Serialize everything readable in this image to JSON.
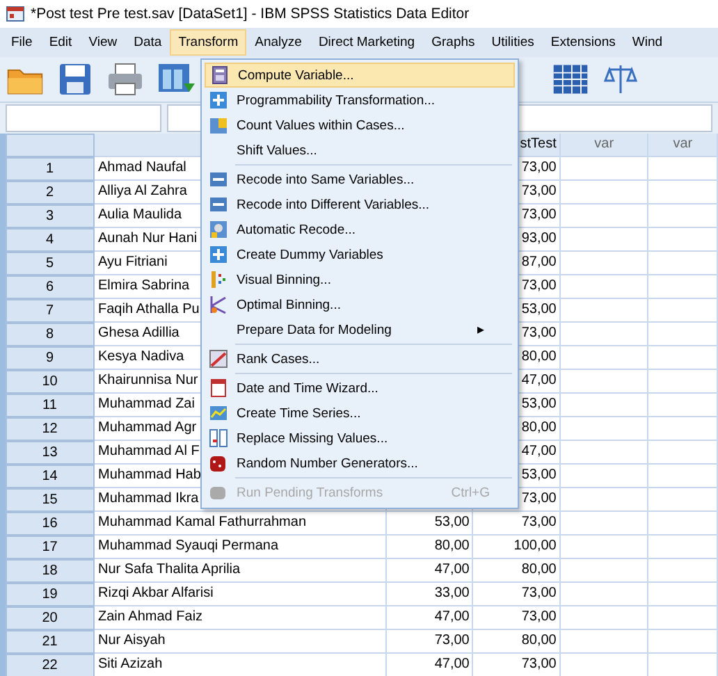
{
  "window": {
    "title": "*Post test Pre test.sav [DataSet1] - IBM SPSS Statistics Data Editor"
  },
  "menu_bar": [
    {
      "label": "File",
      "selected": false
    },
    {
      "label": "Edit",
      "selected": false
    },
    {
      "label": "View",
      "selected": false
    },
    {
      "label": "Data",
      "selected": false
    },
    {
      "label": "Transform",
      "selected": true
    },
    {
      "label": "Analyze",
      "selected": false
    },
    {
      "label": "Direct Marketing",
      "selected": false
    },
    {
      "label": "Graphs",
      "selected": false
    },
    {
      "label": "Utilities",
      "selected": false
    },
    {
      "label": "Extensions",
      "selected": false
    },
    {
      "label": "Wind",
      "selected": false
    }
  ],
  "grid": {
    "columns": [
      {
        "label": "stTest"
      },
      {
        "label": "var"
      },
      {
        "label": "var"
      }
    ],
    "rows": [
      {
        "num": "1",
        "name": "Ahmad Naufal",
        "post": "73,00"
      },
      {
        "num": "2",
        "name": "Alliya Al Zahra",
        "post": "73,00"
      },
      {
        "num": "3",
        "name": "Aulia Maulida",
        "post": "73,00"
      },
      {
        "num": "4",
        "name": "Aunah Nur Hani",
        "post": "93,00"
      },
      {
        "num": "5",
        "name": "Ayu Fitriani",
        "post": "87,00"
      },
      {
        "num": "6",
        "name": "Elmira Sabrina",
        "post": "73,00"
      },
      {
        "num": "7",
        "name": "Faqih Athalla Pu",
        "post": "53,00"
      },
      {
        "num": "8",
        "name": "Ghesa Adillia",
        "post": "73,00"
      },
      {
        "num": "9",
        "name": "Kesya Nadiva",
        "post": "80,00"
      },
      {
        "num": "10",
        "name": "Khairunnisa Nur",
        "post": "47,00"
      },
      {
        "num": "11",
        "name": "Muhammad Zai",
        "post": "53,00"
      },
      {
        "num": "12",
        "name": "Muhammad Agr",
        "post": "80,00"
      },
      {
        "num": "13",
        "name": "Muhammad Al F",
        "post": "47,00"
      },
      {
        "num": "14",
        "name": "Muhammad Hab",
        "post": "53,00"
      },
      {
        "num": "15",
        "name": "Muhammad Ikra",
        "post": "73,00"
      },
      {
        "num": "16",
        "name": "Muhammad Kamal Fathurrahman",
        "pre": "53,00",
        "post": "73,00"
      },
      {
        "num": "17",
        "name": "Muhammad Syauqi Permana",
        "pre": "80,00",
        "post": "100,00"
      },
      {
        "num": "18",
        "name": "Nur Safa Thalita Aprilia",
        "pre": "47,00",
        "post": "80,00"
      },
      {
        "num": "19",
        "name": "Rizqi Akbar Alfarisi",
        "pre": "33,00",
        "post": "73,00"
      },
      {
        "num": "20",
        "name": "Zain Ahmad Faiz",
        "pre": "47,00",
        "post": "73,00"
      },
      {
        "num": "21",
        "name": "Nur Aisyah",
        "pre": "73,00",
        "post": "80,00"
      },
      {
        "num": "22",
        "name": "Siti Azizah",
        "pre": "47,00",
        "post": "73,00"
      }
    ]
  },
  "dropdown": [
    {
      "kind": "item",
      "label": "Compute Variable...",
      "selected": true,
      "disabled": false
    },
    {
      "kind": "item",
      "label": "Programmability Transformation...",
      "selected": false,
      "disabled": false
    },
    {
      "kind": "item",
      "label": "Count Values within Cases...",
      "selected": false,
      "disabled": false
    },
    {
      "kind": "item",
      "label": "Shift Values...",
      "selected": false,
      "disabled": false
    },
    {
      "kind": "separator"
    },
    {
      "kind": "item",
      "label": "Recode into Same Variables...",
      "selected": false,
      "disabled": false
    },
    {
      "kind": "item",
      "label": "Recode into Different Variables...",
      "selected": false,
      "disabled": false
    },
    {
      "kind": "item",
      "label": "Automatic Recode...",
      "selected": false,
      "disabled": false
    },
    {
      "kind": "item",
      "label": "Create Dummy Variables",
      "selected": false,
      "disabled": false
    },
    {
      "kind": "item",
      "label": "Visual Binning...",
      "selected": false,
      "disabled": false
    },
    {
      "kind": "item",
      "label": "Optimal Binning...",
      "selected": false,
      "disabled": false
    },
    {
      "kind": "submenu",
      "label": "Prepare Data for Modeling",
      "arrow": "▸"
    },
    {
      "kind": "separator"
    },
    {
      "kind": "item",
      "label": "Rank Cases...",
      "selected": false,
      "disabled": false
    },
    {
      "kind": "separator"
    },
    {
      "kind": "item",
      "label": "Date and Time Wizard...",
      "selected": false,
      "disabled": false
    },
    {
      "kind": "item",
      "label": "Create Time Series...",
      "selected": false,
      "disabled": false
    },
    {
      "kind": "item",
      "label": "Replace Missing Values...",
      "selected": false,
      "disabled": false
    },
    {
      "kind": "item",
      "label": "Random Number Generators...",
      "selected": false,
      "disabled": false
    },
    {
      "kind": "separator"
    },
    {
      "kind": "item",
      "label": "Run Pending Transforms",
      "shortcut": "Ctrl+G",
      "selected": false,
      "disabled": true
    }
  ]
}
